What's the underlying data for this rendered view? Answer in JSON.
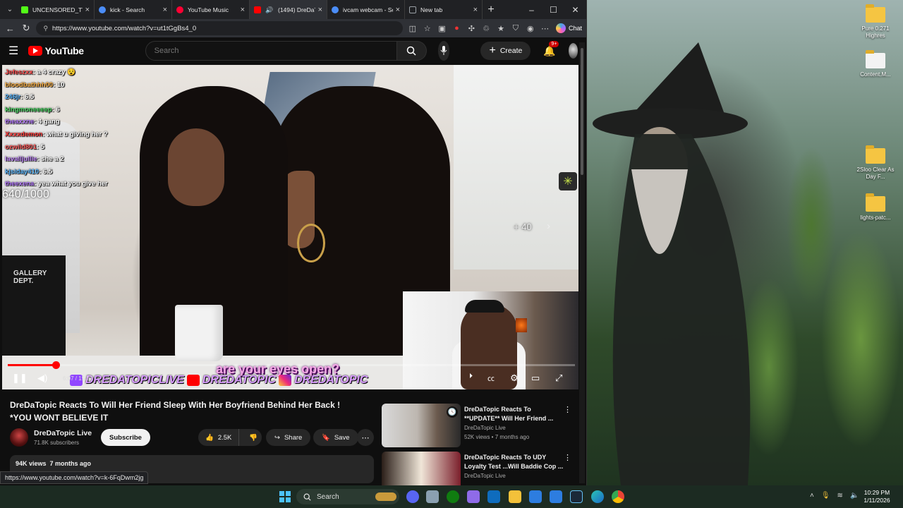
{
  "browser": {
    "tabs": [
      {
        "label": "UNCENSORED_TV Sl",
        "color": "#53fc18",
        "active": false
      },
      {
        "label": "kick - Search",
        "color": "#4b8df8",
        "active": false
      },
      {
        "label": "YouTube Music",
        "color": "#ff0033",
        "active": false
      },
      {
        "label": "(1494) DreDaTo",
        "color": "#ff0000",
        "active": true
      },
      {
        "label": "ivcam webcam - Sea",
        "color": "#4b8df8",
        "active": false
      },
      {
        "label": "New tab",
        "color": "#9aa0a6",
        "active": false
      }
    ],
    "url": "https://www.youtube.com/watch?v=ut1tGgBs4_0",
    "chat_label": "Chat",
    "status_url": "https://www.youtube.com/watch?v=k-6FqDwm2jg"
  },
  "youtube": {
    "logo_text": "YouTube",
    "search_placeholder": "Search",
    "create_label": "Create",
    "notif_badge": "9+"
  },
  "player": {
    "chat": [
      {
        "user": "Jefeszxx",
        "msg": "a 4 crazy 😵",
        "color": "#ff4d4d"
      },
      {
        "user": "bloodbathhh00",
        "msg": "10",
        "color": "#ffb347"
      },
      {
        "user": "246jr",
        "msg": "6.5",
        "color": "#5ab7ff"
      },
      {
        "user": "kingmoneeeep",
        "msg": "6",
        "color": "#4cd964"
      },
      {
        "user": "theaxxne",
        "msg": "4 gang",
        "color": "#b57bff"
      },
      {
        "user": "Xxxxdemon",
        "msg": "what u giving her ?",
        "color": "#ff3b3b"
      },
      {
        "user": "ozwild801",
        "msg": "5",
        "color": "#ff5e5e"
      },
      {
        "user": "lavalljullie",
        "msg": "she a 2",
        "color": "#c58cff"
      },
      {
        "user": "kjsiday410",
        "msg": "6.5",
        "color": "#5ab7ff"
      },
      {
        "user": "theexena",
        "msg": "yea what you give her",
        "color": "#b57bff"
      }
    ],
    "counter": "640/1000",
    "plus_label": "+ 40",
    "caption": "are your eyes open?",
    "banner": [
      "DREDATOPICLIVE",
      "DREDATOPIC",
      "DREDATOPIC"
    ],
    "time": "6:07 / 15:32",
    "progress": 0.085
  },
  "video": {
    "title": "DreDaTopic Reacts To Will Her Friend Sleep With Her Boyfriend Behind Her Back ! *YOU WONT BELIEVE IT",
    "channel": "DreDaTopic Live",
    "subscribers": "71.8K subscribers",
    "subscribe_label": "Subscribe",
    "likes": "2.5K",
    "share_label": "Share",
    "save_label": "Save",
    "views": "94K views",
    "age": "7 months ago"
  },
  "recommendations": [
    {
      "title": "DreDaTopic Reacts To **UPDATE** Will Her Friend ...",
      "channel": "DreDaTopic Live",
      "meta": "52K views • 7 months ago"
    },
    {
      "title": "DreDaTopic Reacts To UDY Loyalty Test ...Will Baddie Cop ...",
      "channel": "DreDaTopic Live",
      "meta": ""
    }
  ],
  "desktop": {
    "icons": [
      {
        "label": "Pure 0.271 Highres"
      },
      {
        "label": "Content.M..."
      },
      {
        "label": "2Sloo Clear As Day F..."
      },
      {
        "label": "lights-patc..."
      }
    ]
  },
  "taskbar": {
    "search_label": "Search",
    "time": "10:29 PM",
    "date": "1/11/2026"
  }
}
